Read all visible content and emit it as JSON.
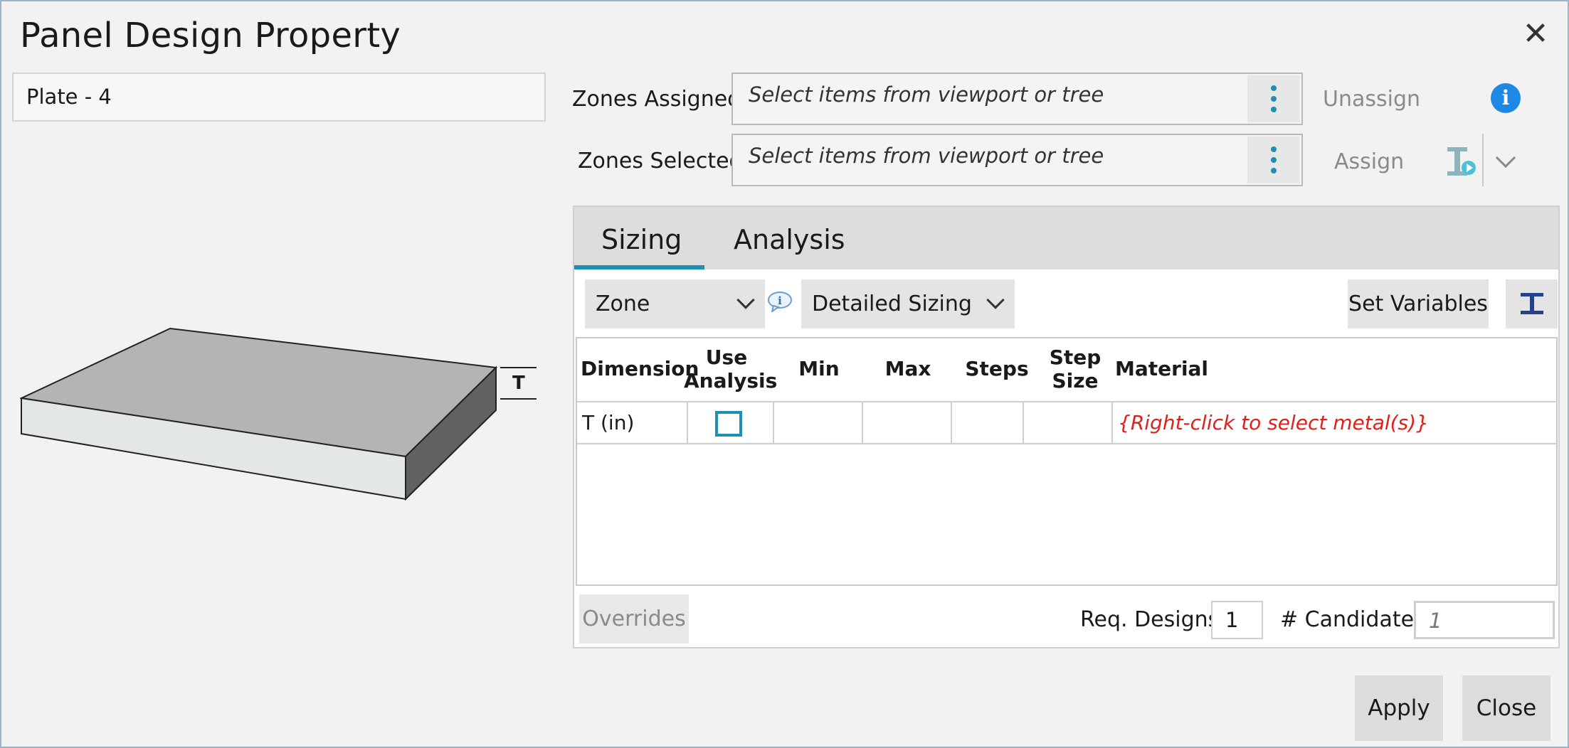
{
  "dialog": {
    "title": "Panel Design Property",
    "close_glyph": "✕"
  },
  "item_name": "Plate - 4",
  "illustration": {
    "dimension_label": "T"
  },
  "zones": {
    "assigned_label": "Zones Assigned:",
    "selected_label": "Zones Selected:",
    "assigned_placeholder": "Select items from viewport or tree",
    "selected_placeholder": "Select items from viewport or tree",
    "unassign_label": "Unassign",
    "assign_label": "Assign",
    "info_glyph": "i"
  },
  "tabs": [
    {
      "label": "Sizing",
      "active": true
    },
    {
      "label": "Analysis",
      "active": false
    }
  ],
  "toolbar": {
    "scope_value": "Zone",
    "sizing_mode_value": "Detailed Sizing",
    "set_variables_label": "Set Variables"
  },
  "table": {
    "headers": {
      "dimension": "Dimension",
      "use_analysis_1": "Use",
      "use_analysis_2": "Analysis",
      "min": "Min",
      "max": "Max",
      "steps": "Steps",
      "step_size_1": "Step",
      "step_size_2": "Size",
      "material": "Material"
    },
    "rows": [
      {
        "dimension": "T (in)",
        "use_analysis": false,
        "min": "",
        "max": "",
        "steps": "",
        "step_size": "",
        "material": "{Right-click to select metal(s)}"
      }
    ]
  },
  "footer": {
    "overrides_label": "Overrides",
    "req_designs_label": "Req. Designs",
    "req_designs_value": "1",
    "candidates_label": "# Candidates",
    "candidates_placeholder": "1"
  },
  "actions": {
    "apply_label": "Apply",
    "close_label": "Close"
  },
  "colors": {
    "accent": "#1f8db4",
    "info_blue": "#1e88e5",
    "material_hint_red": "#e0201b"
  },
  "icons": {
    "close": "close-icon",
    "kebab": "more-vertical-icon",
    "info": "info-icon",
    "assign_tool": "beam-assign-icon",
    "chevron": "chevron-down-icon",
    "small_info": "info-bubble-icon",
    "beam_shape": "i-beam-icon"
  }
}
